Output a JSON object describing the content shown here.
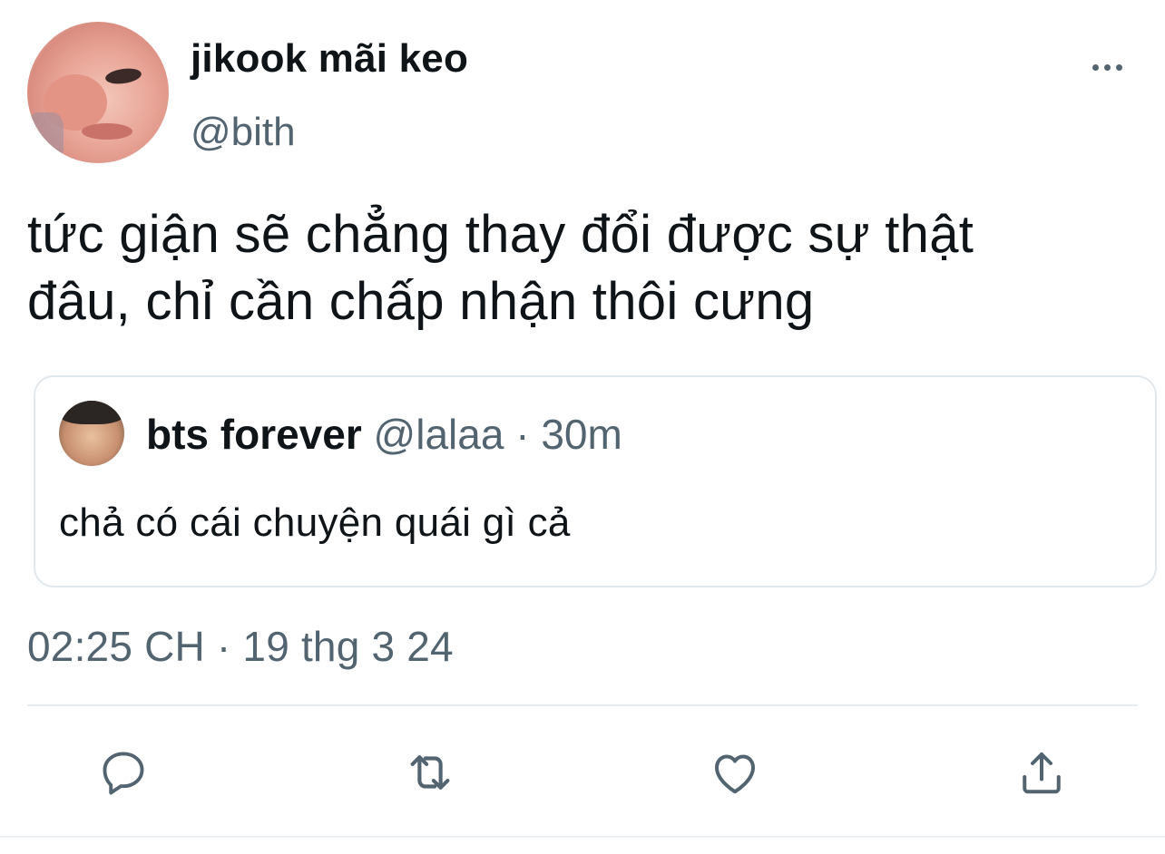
{
  "tweet": {
    "author": {
      "display_name": "jikook mãi keo",
      "handle": "@bith"
    },
    "text_lines": [
      "tức giận sẽ chẳng thay đổi được sự thật",
      "đâu, chỉ cần chấp nhận thôi cưng"
    ],
    "timestamp": "02:25 CH · 19 thg 3 24"
  },
  "quoted_tweet": {
    "display_name": "bts forever",
    "handle": "@lalaa",
    "separator": "·",
    "time_ago": "30m",
    "text": "chả có cái chuyện quái gì cả"
  },
  "icons": {
    "more": "more-horizontal-icon",
    "reply": "reply-icon",
    "retweet": "retweet-icon",
    "like": "like-icon",
    "share": "share-icon"
  },
  "colors": {
    "text_primary": "#0f1419",
    "text_secondary": "#536471",
    "border": "#e1e8ed"
  }
}
